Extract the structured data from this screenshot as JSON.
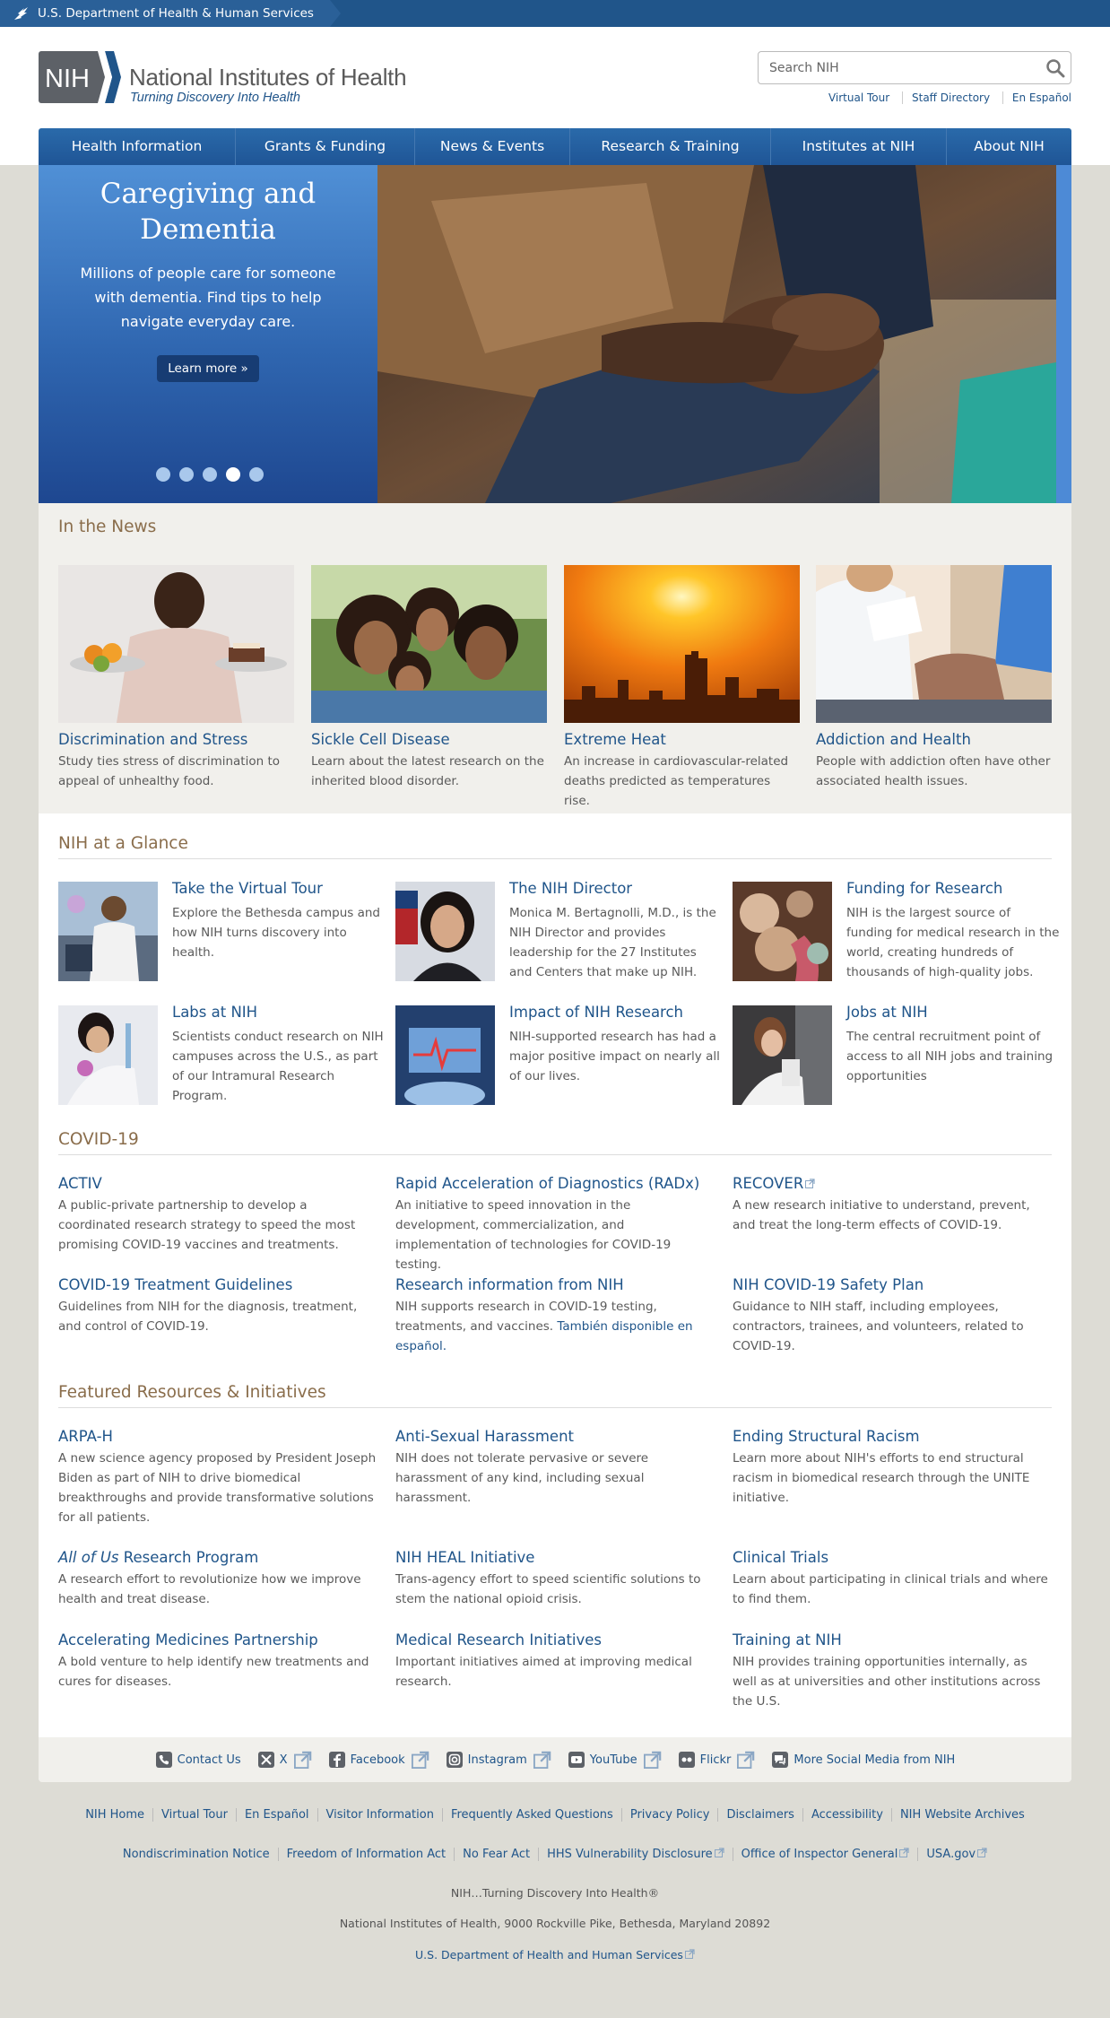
{
  "hhs": {
    "label": "U.S. Department of Health & Human Services"
  },
  "header": {
    "logo_abbr": "NIH",
    "logo_title": "National Institutes of Health",
    "logo_tagline": "Turning Discovery Into Health",
    "search_placeholder": "Search NIH",
    "util_links": [
      "Virtual Tour",
      "Staff Directory",
      "En Español"
    ]
  },
  "nav": [
    "Health Information",
    "Grants & Funding",
    "News & Events",
    "Research & Training",
    "Institutes at NIH",
    "About NIH"
  ],
  "hero": {
    "title": "Caregiving and Dementia",
    "text": "Millions of people care for someone with dementia. Find tips to help navigate everyday care.",
    "button": "Learn more »",
    "slide_count": 5,
    "active_slide": 4
  },
  "news": {
    "title": "In the News",
    "items": [
      {
        "title": "Discrimination and Stress",
        "desc": "Study ties stress of discrimination to appeal of unhealthy food."
      },
      {
        "title": "Sickle Cell Disease",
        "desc": "Learn about the latest research on the inherited blood disorder."
      },
      {
        "title": "Extreme Heat",
        "desc": "An increase in cardiovascular-related deaths predicted as temperatures rise."
      },
      {
        "title": "Addiction and Health",
        "desc": "People with addiction often have other associated health issues."
      }
    ]
  },
  "glance": {
    "title": "NIH at a Glance",
    "items": [
      {
        "title": "Take the Virtual Tour",
        "desc": "Explore the Bethesda campus and how NIH turns discovery into health."
      },
      {
        "title": "The NIH Director",
        "desc": "Monica M. Bertagnolli, M.D., is the NIH Director and provides leadership for the 27 Institutes and Centers that make up NIH."
      },
      {
        "title": "Funding for Research",
        "desc": "NIH is the largest source of funding for medical research in the world, creating hundreds of thousands of high-quality jobs."
      },
      {
        "title": "Labs at NIH",
        "desc": "Scientists conduct research on NIH campuses across the U.S., as part of our Intramural Research Program."
      },
      {
        "title": "Impact of NIH Research",
        "desc": "NIH-supported research has had a major positive impact on nearly all of our lives."
      },
      {
        "title": "Jobs at NIH",
        "desc": "The central recruitment point of access to all NIH jobs and training opportunities"
      }
    ]
  },
  "covid": {
    "title": "COVID-19",
    "items": [
      {
        "title": "ACTIV",
        "desc": "A public-private partnership to develop a coordinated research strategy to speed the most promising COVID-19 vaccines and treatments."
      },
      {
        "title": "Rapid Acceleration of Diagnostics (RADx)",
        "desc": "An initiative to speed innovation in the development, commercialization, and implementation of technologies for COVID-19 testing."
      },
      {
        "title": "RECOVER",
        "desc": "A new research initiative to understand, prevent, and treat the long-term effects of COVID-19."
      },
      {
        "title": "COVID-19 Treatment Guidelines",
        "desc": "Guidelines from NIH for the diagnosis, treatment, and control of COVID-19."
      },
      {
        "title": "Research information from NIH",
        "desc": "NIH supports research in COVID-19 testing, treatments, and vaccines.",
        "link": "También disponible en español."
      },
      {
        "title": "NIH COVID-19 Safety Plan",
        "desc": "Guidance to NIH staff, including employees, contractors, trainees, and volunteers, related to COVID-19."
      }
    ]
  },
  "featured": {
    "title": "Featured Resources & Initiatives",
    "items": [
      {
        "title": "ARPA-H",
        "desc": "A new science agency proposed by President Joseph Biden as part of NIH to drive biomedical breakthroughs and provide transformative solutions for all patients."
      },
      {
        "title": "Anti-Sexual Harassment",
        "desc": "NIH does not tolerate pervasive or severe harassment of any kind, including sexual harassment."
      },
      {
        "title": "Ending Structural Racism",
        "desc": "Learn more about NIH's efforts to end structural racism in biomedical research through the UNITE initiative."
      },
      {
        "title_italic": "All of Us",
        "title_rest": " Research Program",
        "desc": "A research effort to revolutionize how we improve health and treat disease."
      },
      {
        "title": "NIH HEAL Initiative",
        "desc": "Trans-agency effort to speed scientific solutions to stem the national opioid crisis."
      },
      {
        "title": "Clinical Trials",
        "desc": "Learn about participating in clinical trials and where to find them."
      },
      {
        "title": "Accelerating Medicines Partnership",
        "desc": "A bold venture to help identify new treatments and cures for diseases."
      },
      {
        "title": "Medical Research Initiatives",
        "desc": "Important initiatives aimed at improving medical research."
      },
      {
        "title": "Training at NIH",
        "desc": "NIH provides training opportunities internally, as well as at universities and other institutions across the U.S."
      }
    ]
  },
  "social": [
    "Contact Us",
    "X",
    "Facebook",
    "Instagram",
    "YouTube",
    "Flickr",
    "More Social Media from NIH"
  ],
  "footer": {
    "row1": [
      "NIH Home",
      "Virtual Tour",
      "En Español",
      "Visitor Information",
      "Frequently Asked Questions",
      "Privacy Policy",
      "Disclaimers",
      "Accessibility",
      "NIH Website Archives"
    ],
    "row2": [
      "Nondiscrimination Notice",
      "Freedom of Information Act",
      "No Fear Act",
      "HHS Vulnerability Disclosure",
      "Office of Inspector General",
      "USA.gov"
    ],
    "tagline": "NIH…Turning Discovery Into Health®",
    "address": "National Institutes of Health, 9000 Rockville Pike, Bethesda, Maryland 20892",
    "hhs_link": "U.S. Department of Health and Human Services"
  },
  "colors": {
    "brand_blue": "#20558a",
    "section_brown": "#8a6d4b",
    "page_bg": "#dddcd5"
  }
}
